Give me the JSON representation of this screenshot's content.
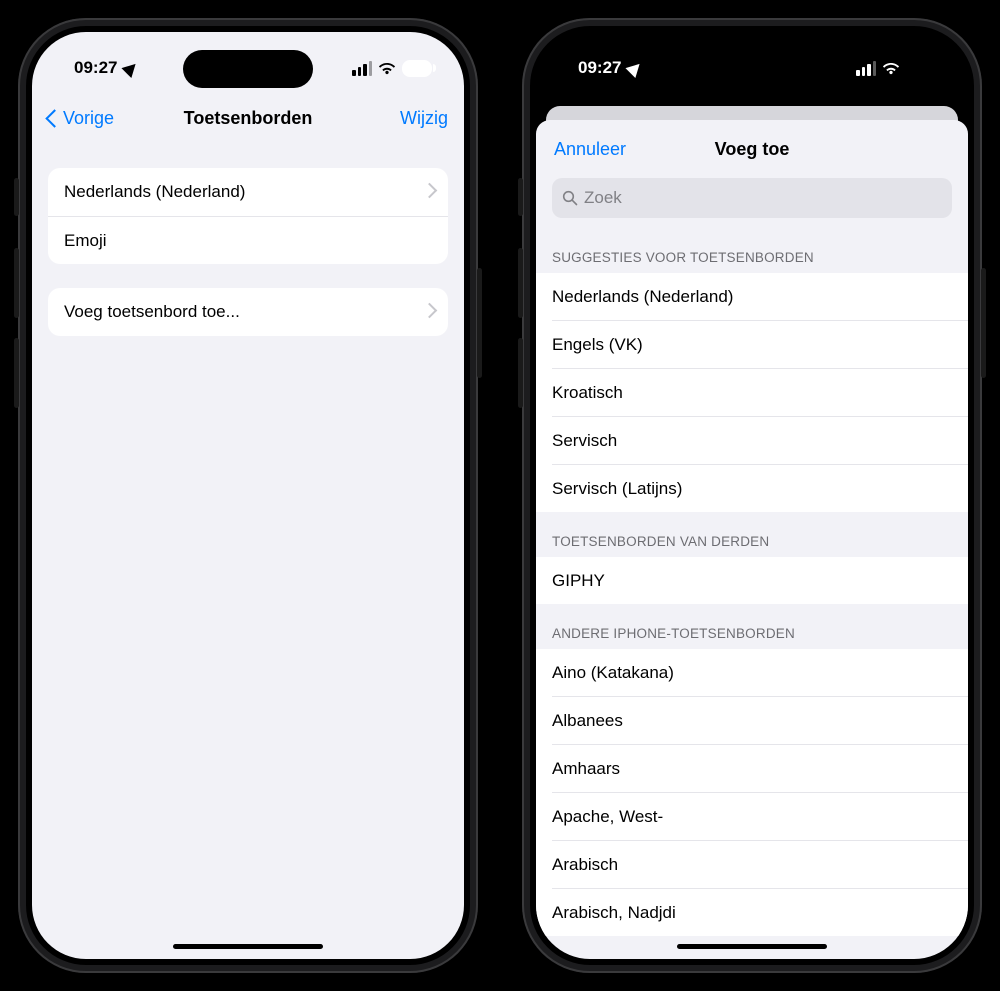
{
  "status": {
    "time": "09:27",
    "battery": "92"
  },
  "phone1": {
    "nav": {
      "back": "Vorige",
      "title": "Toetsenborden",
      "edit": "Wijzig"
    },
    "keyboards": [
      {
        "label": "Nederlands (Nederland)",
        "disclosure": true
      },
      {
        "label": "Emoji",
        "disclosure": false
      }
    ],
    "add_row": "Voeg toetsenbord toe..."
  },
  "phone2": {
    "nav": {
      "cancel": "Annuleer",
      "title": "Voeg toe"
    },
    "search_placeholder": "Zoek",
    "sections": [
      {
        "header": "SUGGESTIES VOOR TOETSENBORDEN",
        "items": [
          "Nederlands (Nederland)",
          "Engels (VK)",
          "Kroatisch",
          "Servisch",
          "Servisch (Latijns)"
        ]
      },
      {
        "header": "TOETSENBORDEN VAN DERDEN",
        "items": [
          "GIPHY"
        ]
      },
      {
        "header": "ANDERE IPHONE-TOETSENBORDEN",
        "items": [
          "Aino (Katakana)",
          "Albanees",
          "Amhaars",
          "Apache, West-",
          "Arabisch",
          "Arabisch, Nadjdi"
        ]
      }
    ]
  }
}
